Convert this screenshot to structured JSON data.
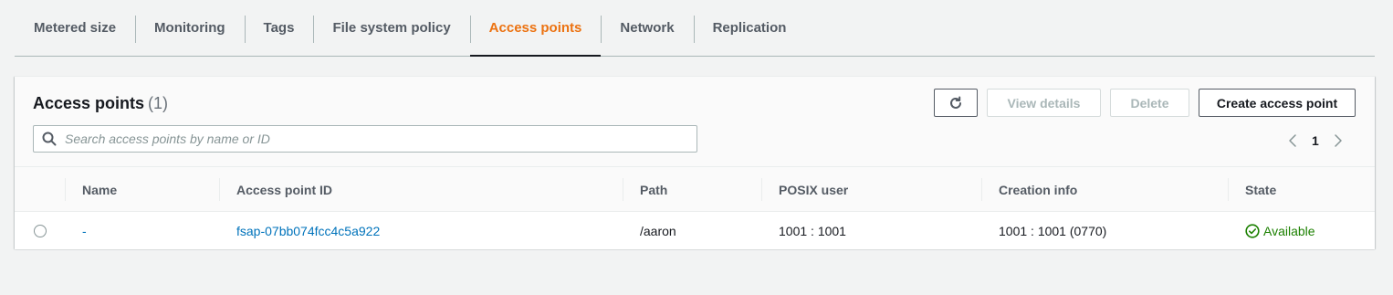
{
  "tabs": [
    {
      "label": "Metered size"
    },
    {
      "label": "Monitoring"
    },
    {
      "label": "Tags"
    },
    {
      "label": "File system policy"
    },
    {
      "label": "Access points"
    },
    {
      "label": "Network"
    },
    {
      "label": "Replication"
    }
  ],
  "active_tab": "Access points",
  "panel": {
    "title": "Access points",
    "count": "(1)",
    "buttons": {
      "view_details": "View details",
      "delete": "Delete",
      "create": "Create access point"
    },
    "search_placeholder": "Search access points by name or ID",
    "pagination": {
      "current_page": "1"
    }
  },
  "table": {
    "columns": [
      "Name",
      "Access point ID",
      "Path",
      "POSIX user",
      "Creation info",
      "State"
    ],
    "rows": [
      {
        "name": "-",
        "id": "fsap-07bb074fcc4c5a922",
        "path": "/aaron",
        "posix_user": "1001 : 1001",
        "creation_info": "1001 : 1001 (0770)",
        "state": "Available"
      }
    ]
  },
  "colors": {
    "accent": "#ec7211",
    "link": "#0073bb",
    "success": "#1d8102"
  },
  "icons": [
    "refresh-icon",
    "search-icon",
    "chevron-left-icon",
    "chevron-right-icon",
    "check-circle-icon"
  ]
}
